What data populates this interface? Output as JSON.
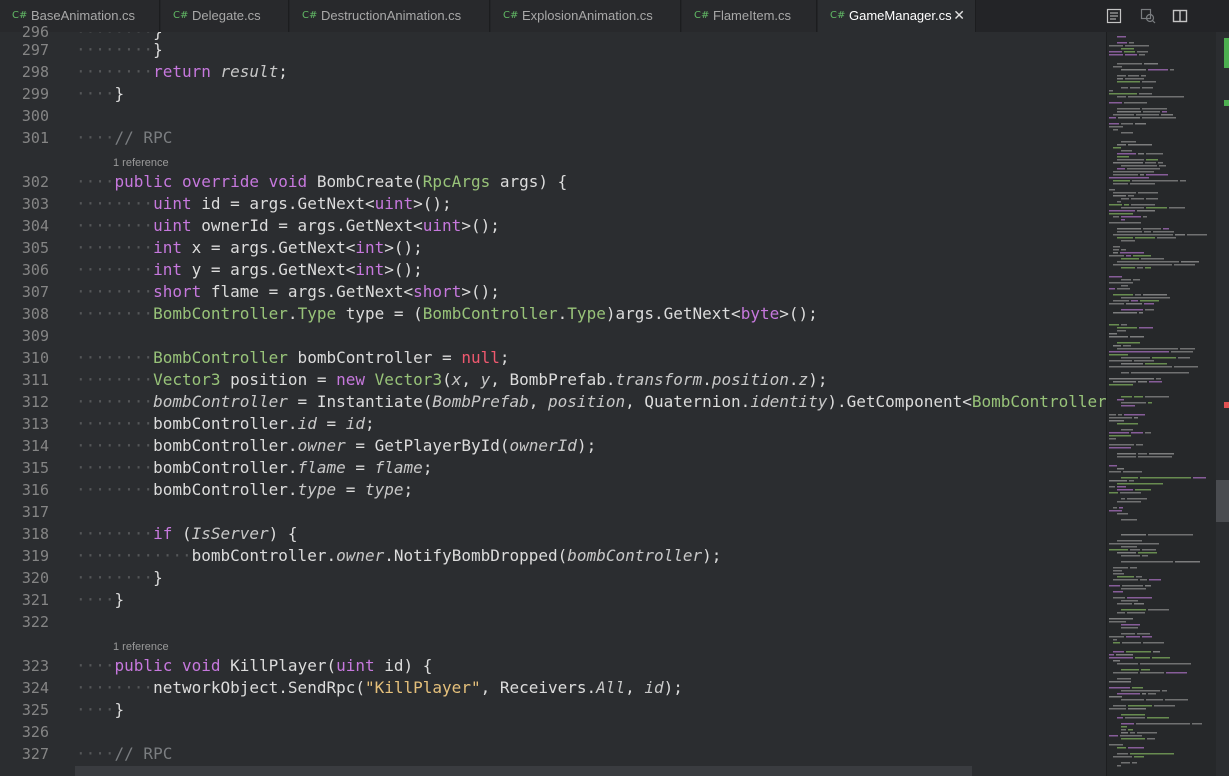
{
  "tabs": [
    {
      "icon": "C#",
      "label": "BaseAnimation.cs"
    },
    {
      "icon": "C#",
      "label": "Delegate.cs"
    },
    {
      "icon": "C#",
      "label": "DestructionAnimation.cs"
    },
    {
      "icon": "C#",
      "label": "ExplosionAnimation.cs"
    },
    {
      "icon": "C#",
      "label": "FlameItem.cs"
    },
    {
      "icon": "C#",
      "label": "GameManager.cs",
      "active": true
    }
  ],
  "close_glyph": "✕",
  "toolbar": {
    "icons": [
      "split-preview-icon",
      "open-changes-icon",
      "split-editor-icon"
    ]
  },
  "codelens": [
    "1 reference",
    "1 reference"
  ],
  "line_numbers": [
    "296",
    "297",
    "298",
    "299",
    "300",
    "301",
    "302",
    "303",
    "304",
    "305",
    "306",
    "307",
    "308",
    "309",
    "310",
    "311",
    "312",
    "313",
    "314",
    "315",
    "316",
    "317",
    "318",
    "319",
    "320",
    "321",
    "322",
    "323",
    "324",
    "325",
    "326",
    "327"
  ],
  "colors": {
    "keyword": "#c678dd",
    "type": "#98c379",
    "string": "#e5c07b",
    "null": "#ef596f",
    "comment": "#7a7d80",
    "background": "#2b2d30"
  }
}
